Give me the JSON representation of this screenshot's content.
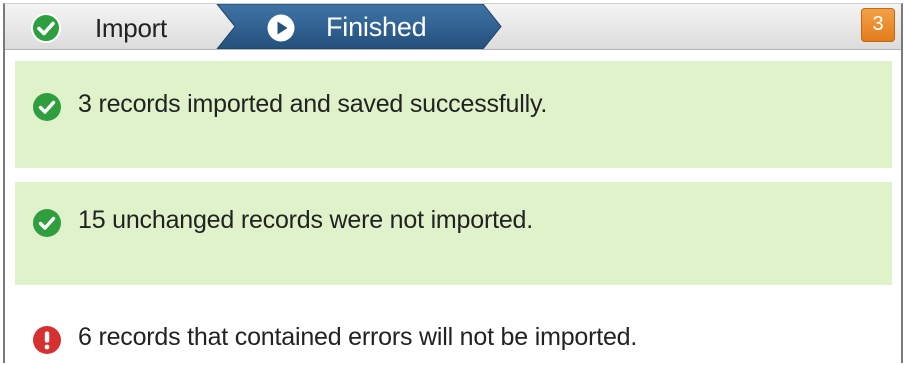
{
  "wizard": {
    "steps": [
      {
        "label": "Import",
        "state": "complete",
        "icon": "check-circle-icon"
      },
      {
        "label": "Finished",
        "state": "current",
        "icon": "play-circle-icon"
      }
    ],
    "badge": "3"
  },
  "messages": [
    {
      "type": "success",
      "icon": "check-circle-icon",
      "text": "3 records imported and saved successfully."
    },
    {
      "type": "success",
      "icon": "check-circle-icon",
      "text": "15 unchanged records were not imported."
    },
    {
      "type": "error",
      "icon": "error-exclamation-icon",
      "text": "6 records that contained errors will not be imported."
    }
  ],
  "colors": {
    "success_bg": "#dff2c9",
    "success_icon": "#2e9e3f",
    "error_icon": "#d63030",
    "step_active": "#2e5c8a",
    "badge": "#e8891f"
  }
}
